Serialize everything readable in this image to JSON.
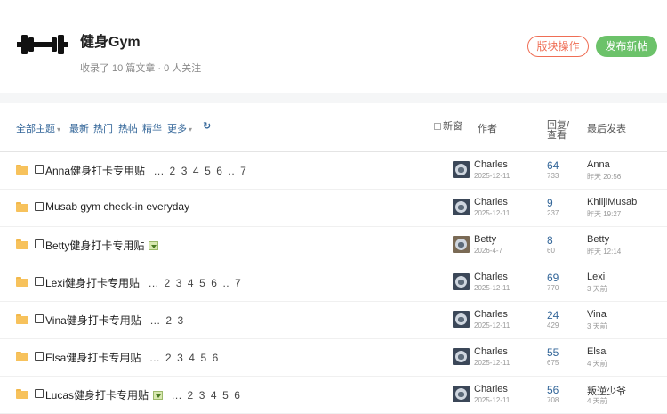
{
  "forum": {
    "title": "健身Gym",
    "stats": "收录了 10 篇文章 · 0 人关注",
    "manage_label": "版块操作",
    "post_label": "发布新帖"
  },
  "filters": {
    "all": "全部主题",
    "latest": "最新",
    "hot": "热门",
    "hot_posts": "热帖",
    "digest": "精华",
    "more": "更多"
  },
  "columns": {
    "new_window": "新窗",
    "author": "作者",
    "replies_views": "回复/查看",
    "last_post": "最后发表"
  },
  "icons": {
    "forum": "dumbbell-icon",
    "refresh": "refresh-icon",
    "thread": "folder-icon"
  },
  "colors": {
    "manage": "#ef6e55",
    "post": "#6cc26a",
    "link": "#336699"
  },
  "threads": [
    {
      "title": "Anna健身打卡专用贴",
      "has_image": false,
      "pages": [
        "...",
        "2",
        "3",
        "4",
        "5",
        "6",
        "..",
        "7"
      ],
      "author": "Charles",
      "author_date": "2025-12-11",
      "replies": "64",
      "views": "733",
      "last_user": "Anna",
      "last_time": "昨天 20:56"
    },
    {
      "title": "Musab gym check-in everyday",
      "has_image": false,
      "pages": [],
      "author": "Charles",
      "author_date": "2025-12-11",
      "replies": "9",
      "views": "237",
      "last_user": "KhiljiMusab",
      "last_time": "昨天 19:27"
    },
    {
      "title": "Betty健身打卡专用贴",
      "has_image": true,
      "pages": [],
      "author": "Betty",
      "author_date": "2026-4-7",
      "replies": "8",
      "views": "60",
      "last_user": "Betty",
      "last_time": "昨天 12:14"
    },
    {
      "title": "Lexi健身打卡专用贴",
      "has_image": false,
      "pages": [
        "...",
        "2",
        "3",
        "4",
        "5",
        "6",
        "..",
        "7"
      ],
      "author": "Charles",
      "author_date": "2025-12-11",
      "replies": "69",
      "views": "770",
      "last_user": "Lexi",
      "last_time": "3 天前"
    },
    {
      "title": "Vina健身打卡专用贴",
      "has_image": false,
      "pages": [
        "...",
        "2",
        "3"
      ],
      "author": "Charles",
      "author_date": "2025-12-11",
      "replies": "24",
      "views": "429",
      "last_user": "Vina",
      "last_time": "3 天前"
    },
    {
      "title": "Elsa健身打卡专用贴",
      "has_image": false,
      "pages": [
        "...",
        "2",
        "3",
        "4",
        "5",
        "6"
      ],
      "author": "Charles",
      "author_date": "2025-12-11",
      "replies": "55",
      "views": "675",
      "last_user": "Elsa",
      "last_time": "4 天前"
    },
    {
      "title": "Lucas健身打卡专用贴",
      "has_image": true,
      "pages": [
        "...",
        "2",
        "3",
        "4",
        "5",
        "6"
      ],
      "author": "Charles",
      "author_date": "2025-12-11",
      "replies": "56",
      "views": "708",
      "last_user": "叛逆少爷",
      "last_time": "4 天前"
    }
  ]
}
